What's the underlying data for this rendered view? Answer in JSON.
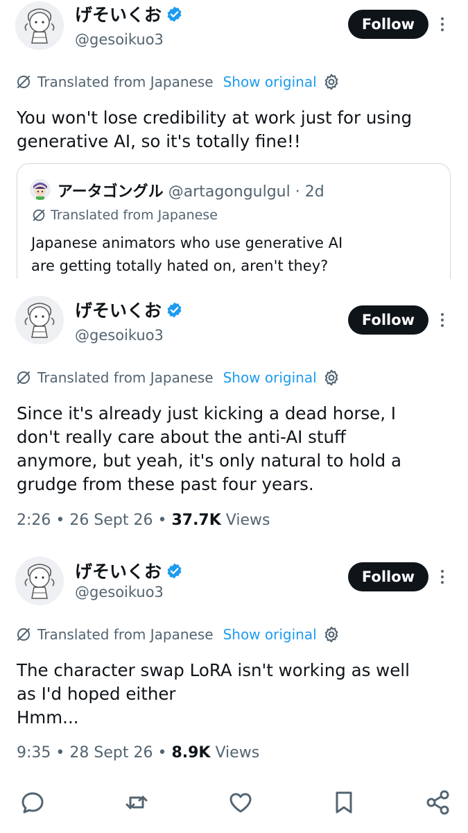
{
  "tweets": [
    {
      "display_name": "げそいくお",
      "handle": "@gesoikuo3",
      "follow_label": "Follow",
      "translated_label": "Translated from Japanese",
      "show_original_label": "Show original",
      "text_lines": [
        "You won't lose credibility at work just for using",
        "generative AI, so it's totally fine!!"
      ],
      "quote": {
        "display_name": "アータゴングル",
        "handle": "@artagongulgul",
        "time": "· 2d",
        "translated_label": "Translated from Japanese",
        "text_lines": [
          "Japanese animators who use generative AI",
          "are getting totally hated on, aren't they?"
        ]
      }
    },
    {
      "display_name": "げそいくお",
      "handle": "@gesoikuo3",
      "follow_label": "Follow",
      "translated_label": "Translated from Japanese",
      "show_original_label": "Show original",
      "text_lines": [
        "Since it's already just kicking a dead horse, I",
        "don't really care about the anti-AI stuff",
        "anymore, but yeah, it's only natural to hold a",
        "grudge from these past four years."
      ],
      "time": "2:26",
      "date": "26 Sept 26",
      "views_count": "37.7K",
      "views_label": "Views"
    },
    {
      "display_name": "げそいくお",
      "handle": "@gesoikuo3",
      "follow_label": "Follow",
      "translated_label": "Translated from Japanese",
      "show_original_label": "Show original",
      "text_lines": [
        "The character swap LoRA isn't working as well",
        "as I'd hoped either",
        "Hmm..."
      ],
      "time": "9:35",
      "date": "28 Sept 26",
      "views_count": "8.9K",
      "views_label": "Views"
    }
  ],
  "actions": [
    "reply-icon",
    "repost-icon",
    "like-icon",
    "bookmark-icon",
    "share-icon"
  ],
  "colors": {
    "accent": "#1d9bf0",
    "text": "#0f1419",
    "secondary": "#536471",
    "follow_bg": "#0f1419"
  },
  "separator_dot": "•"
}
